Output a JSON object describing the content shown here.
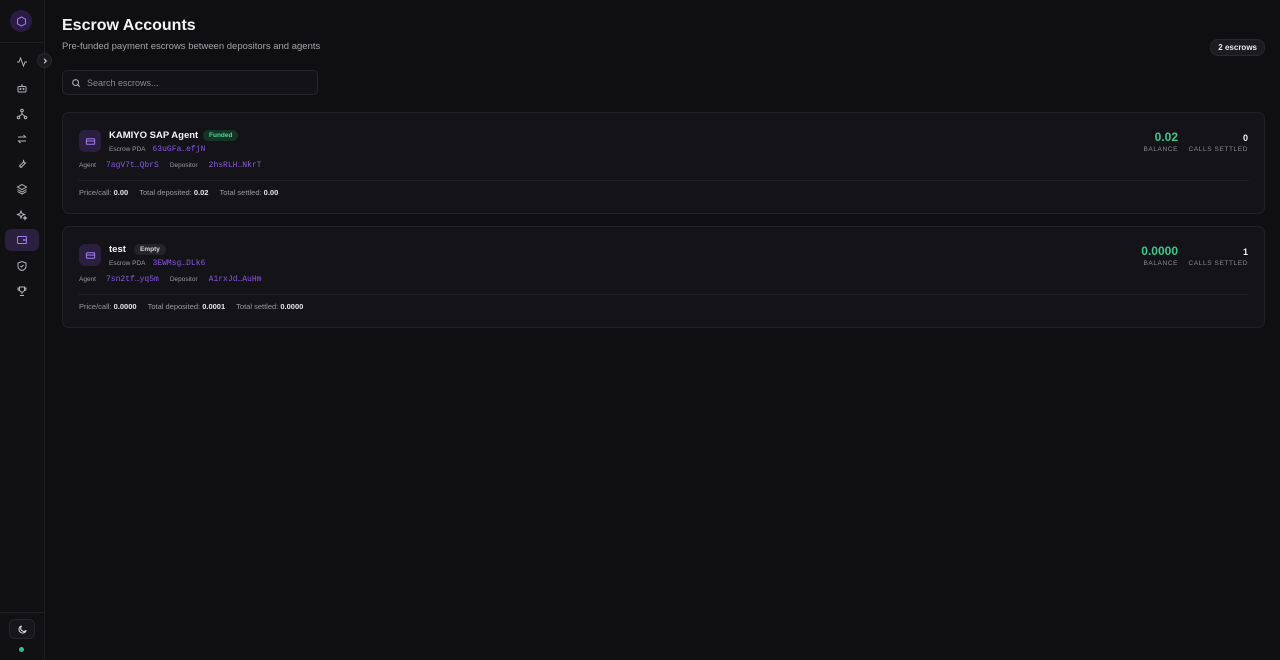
{
  "sidebar": {
    "logo_icon": "hexagon-logo-icon",
    "collapse_icon": "chevron-right-icon",
    "items": [
      {
        "name": "activity",
        "icon": "activity-icon"
      },
      {
        "name": "agents",
        "icon": "bot-icon"
      },
      {
        "name": "network",
        "icon": "network-icon"
      },
      {
        "name": "transfers",
        "icon": "arrows-left-right-icon"
      },
      {
        "name": "tools",
        "icon": "wrench-icon"
      },
      {
        "name": "layers",
        "icon": "layers-icon"
      },
      {
        "name": "sparkles",
        "icon": "sparkles-icon"
      },
      {
        "name": "escrow",
        "icon": "wallet-icon",
        "active": true
      },
      {
        "name": "security",
        "icon": "shield-icon"
      },
      {
        "name": "leaderboard",
        "icon": "trophy-icon"
      }
    ],
    "theme_icon": "moon-icon",
    "status_color": "#2bc48a"
  },
  "header": {
    "title": "Escrow Accounts",
    "subtitle": "Pre-funded payment escrows between depositors and agents",
    "count_badge": "2 escrows"
  },
  "search": {
    "placeholder": "Search escrows..."
  },
  "colors": {
    "accent": "#8a57e8",
    "balance_green": "#39c98c",
    "background": "#0f0e11"
  },
  "escrows": [
    {
      "name": "KAMIYO SAP Agent",
      "status": "Funded",
      "pda_label": "Escrow PDA",
      "pda": "63uGFa…efjN",
      "agent_label": "Agent",
      "agent": "7agV7t…QbrS",
      "depositor_label": "Depositor",
      "depositor": "2hsRLH…NkrT",
      "price_label": "Price/call:",
      "price": "0.00",
      "deposited_label": "Total deposited:",
      "deposited": "0.02",
      "settled_label": "Total settled:",
      "settled": "0.00",
      "balance": "0.02",
      "balance_label": "BALANCE",
      "calls": "0",
      "calls_label": "CALLS SETTLED"
    },
    {
      "name": "test",
      "status": "Empty",
      "pda_label": "Escrow PDA",
      "pda": "3EWMsg…DLk6",
      "agent_label": "Agent",
      "agent": "7sn2tf…yq5m",
      "depositor_label": "Depositor",
      "depositor": "A1rxJd…AuHm",
      "price_label": "Price/call:",
      "price": "0.0000",
      "deposited_label": "Total deposited:",
      "deposited": "0.0001",
      "settled_label": "Total settled:",
      "settled": "0.0000",
      "balance": "0.0000",
      "balance_label": "BALANCE",
      "calls": "1",
      "calls_label": "CALLS SETTLED"
    }
  ]
}
